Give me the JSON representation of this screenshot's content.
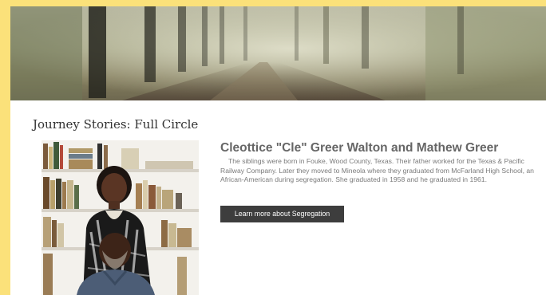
{
  "section": {
    "title": "Journey Stories: Full Circle"
  },
  "story": {
    "name": "Cleottice \"Cle\" Greer Walton and Mathew Greer",
    "text": "The siblings were born in Fouke, Wood County, Texas. Their father worked for the Texas & Pacific Railway Company. Later they moved to Mineola where they graduated from McFarland High School, an African-American during segregation. She  graduated in 1958 and he graduated in 1961.",
    "button_label": "Learn more about Segregation"
  },
  "colors": {
    "page_border": "#fbe17a",
    "button_bg": "#3d3d3d",
    "heading": "#666666"
  }
}
